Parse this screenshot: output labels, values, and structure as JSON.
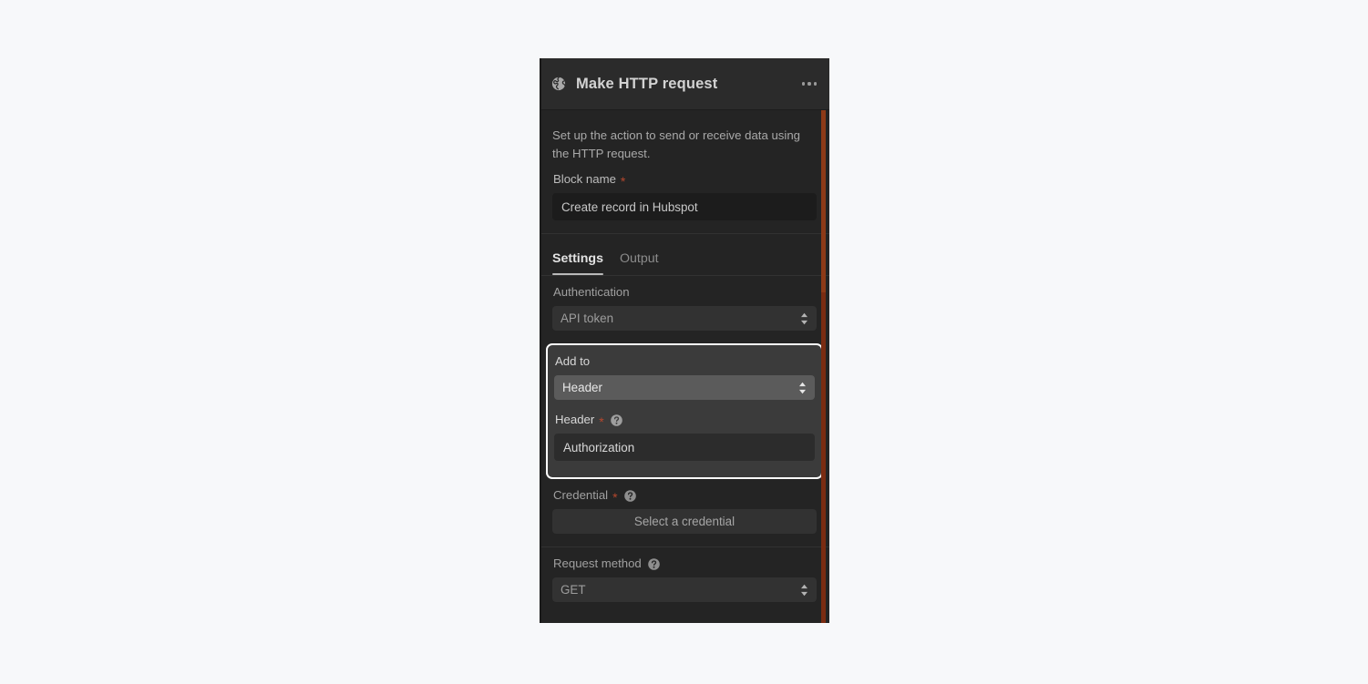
{
  "window": {
    "background_color": "#f7f8fa"
  },
  "panel": {
    "background_color": "#242424",
    "header": {
      "icon": "globe-icon",
      "title": "Make HTTP request",
      "menu_icon": "kebab-menu-icon"
    },
    "intro_text": "Set up the action to send or receive data using the HTTP request.",
    "block_name": {
      "label": "Block name",
      "required_marker": "*",
      "value": "Create record in Hubspot",
      "placeholder": "Block name"
    },
    "tabs": [
      {
        "label": "Settings",
        "active": true
      },
      {
        "label": "Output",
        "active": false
      }
    ],
    "authentication": {
      "label": "Authentication",
      "value": "API token"
    },
    "add_to": {
      "label": "Add to",
      "value": "Header",
      "highlighted": true,
      "header_field": {
        "label": "Header",
        "required_marker": "*",
        "help_icon": "help-circle-icon",
        "value": "Authorization",
        "placeholder": "Header"
      }
    },
    "credential": {
      "label": "Credential",
      "required_marker": "*",
      "help_icon": "help-circle-icon",
      "button_label": "Select a credential"
    },
    "request_method": {
      "label": "Request method",
      "help_icon": "help-circle-icon",
      "value": "GET"
    },
    "scrollbar": {
      "track_color": "#7a2c12",
      "thumb_color": "#8d3a17"
    },
    "colors": {
      "accent_highlight": "#ffffff",
      "required_star": "#b5472d",
      "header_bg": "#2b2b2b",
      "input_bg": "#1c1c1c",
      "select_bg": "#323232",
      "select_active_bg": "#5b5b5b"
    }
  }
}
